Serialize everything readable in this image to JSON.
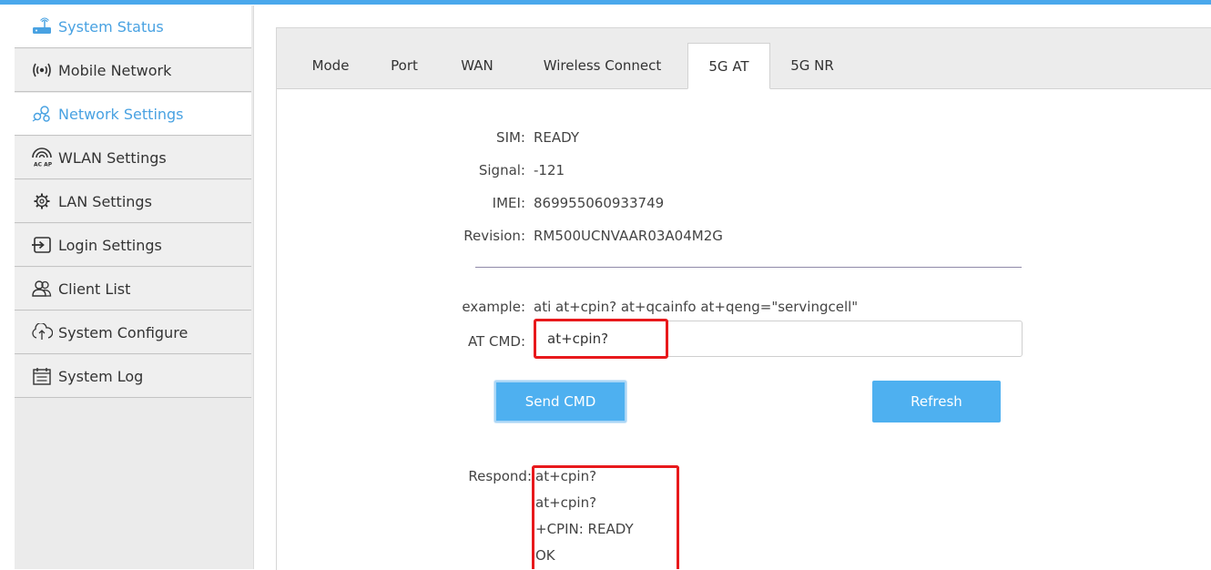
{
  "sidebar": {
    "items": [
      {
        "label": "System Status",
        "icon": "router-icon",
        "active": true
      },
      {
        "label": "Mobile Network",
        "icon": "signal-icon",
        "active": false
      },
      {
        "label": "Network Settings",
        "icon": "network-icon",
        "active": true
      },
      {
        "label": "WLAN Settings",
        "icon": "wlan-icon",
        "active": false
      },
      {
        "label": "LAN Settings",
        "icon": "lan-gear-icon",
        "active": false
      },
      {
        "label": "Login Settings",
        "icon": "login-icon",
        "active": false
      },
      {
        "label": "Client List",
        "icon": "users-icon",
        "active": false
      },
      {
        "label": "System Configure",
        "icon": "upload-cloud-icon",
        "active": false
      },
      {
        "label": "System Log",
        "icon": "calendar-log-icon",
        "active": false
      }
    ]
  },
  "tabs": [
    {
      "label": "Mode",
      "active": false
    },
    {
      "label": "Port",
      "active": false
    },
    {
      "label": "WAN",
      "active": false
    },
    {
      "label": "Wireless Connect",
      "active": false
    },
    {
      "label": "5G AT",
      "active": true
    },
    {
      "label": "5G NR",
      "active": false
    }
  ],
  "status": {
    "sim_label": "SIM:",
    "sim_value": "READY",
    "signal_label": "Signal:",
    "signal_value": "-121",
    "imei_label": "IMEI:",
    "imei_value": "869955060933749",
    "revision_label": "Revision:",
    "revision_value": "RM500UCNVAAR03A04M2G"
  },
  "at": {
    "example_label": "example:",
    "example_value": "ati at+cpin? at+qcainfo at+qeng=\"servingcell\"",
    "cmd_label": "AT CMD:",
    "cmd_value": "at+cpin?",
    "send_label": "Send CMD",
    "refresh_label": "Refresh",
    "respond_label": "Respond:",
    "respond_lines": [
      "at+cpin?",
      "at+cpin?",
      "+CPIN: READY",
      "OK"
    ]
  },
  "colors": {
    "accent": "#49a2e2",
    "button": "#4eb0f0",
    "highlight": "#e8191c"
  }
}
